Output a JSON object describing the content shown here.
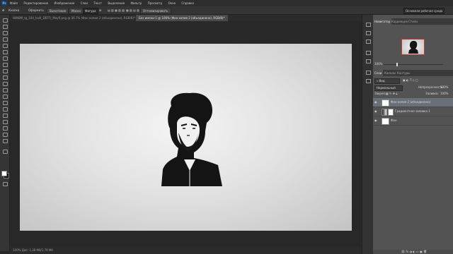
{
  "app": {
    "logo": "Ps"
  },
  "menu": [
    "Файл",
    "Редактирование",
    "Изображение",
    "Слои",
    "Текст",
    "Выделение",
    "Фильтр",
    "Просмотр",
    "Окно",
    "Справка"
  ],
  "options_bar": {
    "autoselect_label": "Кнопка",
    "feather_label": "Оформить",
    "mode_label": "Вычитание",
    "mask_label": "Маска",
    "refine_label": "Фигура",
    "btn_label": "Оптимизировать",
    "workspace_label": "Основная рабочая среда"
  },
  "tabs": [
    {
      "label": "WIN8M_tg_104_hall(_DEFF)_Mayfl.png @ 36.7% (Фон копия 2 (объединено), RGB/8)*",
      "active": false
    },
    {
      "label": "Без имени-1 @ 100% (Фон копия 2 (объединено), RGB/8)*",
      "active": true
    }
  ],
  "status": {
    "text": "100%   Док: 1,38 Мб/1,79 Мб"
  },
  "navigator": {
    "tabs": [
      "Навигатор",
      "Коррекция",
      "Стили"
    ],
    "zoom": "100%"
  },
  "layers_panel": {
    "tabs": [
      "Слои",
      "Каналы",
      "Контуры"
    ],
    "filter_label": "Вид",
    "blend_mode": "Нормальный",
    "opacity_label": "Непрозрачность:",
    "opacity_value": "100%",
    "lock_label": "Закреп.:",
    "fill_label": "Заливка:",
    "fill_value": "100%",
    "layers": [
      {
        "name": "Фон копия 2 (объединено)",
        "selected": true
      },
      {
        "name": "Градиентная заливка 1",
        "selected": false
      },
      {
        "name": "Фон",
        "selected": false
      }
    ]
  },
  "colors": {
    "accent": "#c0392b",
    "selected_layer": "#6a7079",
    "panel_bg": "#535353"
  }
}
